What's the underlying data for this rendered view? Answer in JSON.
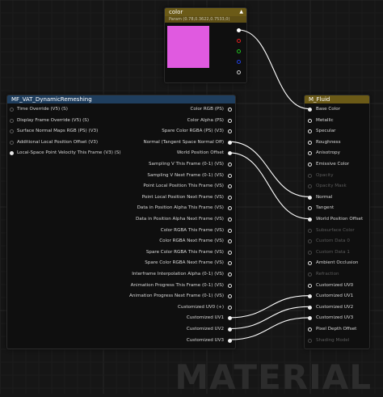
{
  "color_node": {
    "title": "color",
    "subtitle": "Param (0.78,0.3622,0.7533,0)",
    "swatch_color": "#e05ae0",
    "header_color": "#6b5a17",
    "output_pins": [
      "white",
      "red",
      "green",
      "blue",
      "alpha"
    ]
  },
  "mf_node": {
    "title": "MF_VAT_DynamicRemeshing",
    "header_color": "#1f3e5e",
    "inputs": [
      "Time Override (V5) (S)",
      "Display Frame Override (V5) (S)",
      "Surface Normal Maps RGB (PS) (V3)",
      "Additional Local Position Offset (V3)",
      "Local-Space Point Velocity This Frame (V3) (S)"
    ],
    "outputs": [
      "Color RGB (PS)",
      "Color Alpha (PS)",
      "Spare Color RGBA (PS) (V3)",
      "Normal (Tangent Space Normal Off)",
      "World Position Offset",
      "Sampling V This Frame (0-1) (VS)",
      "Sampling V Next Frame (0-1) (VS)",
      "Point Local Position This Frame (VS)",
      "Point Local Position Next Frame (VS)",
      "Data in Position Alpha This Frame (VS)",
      "Data in Position Alpha Next Frame (VS)",
      "Color RGBA This Frame (VS)",
      "Color RGBA Next Frame (VS)",
      "Spare Color RGBA This Frame (VS)",
      "Spare Color RGBA Next Frame (VS)",
      "Interframe Interpolation Alpha (0-1) (VS)",
      "Animation Progress This Frame (0-1) (VS)",
      "Animation Progress Next Frame (0-1) (VS)",
      "Customized UV0 (+)",
      "Customized UV1",
      "Customized UV2",
      "Customized UV3"
    ]
  },
  "fluid_node": {
    "title": "M_Fluid",
    "header_color": "#6b5a17",
    "inputs": [
      {
        "label": "Base Color",
        "dim": false
      },
      {
        "label": "Metallic",
        "dim": false
      },
      {
        "label": "Specular",
        "dim": false
      },
      {
        "label": "Roughness",
        "dim": false
      },
      {
        "label": "Anisotropy",
        "dim": false
      },
      {
        "label": "Emissive Color",
        "dim": false
      },
      {
        "label": "Opacity",
        "dim": true
      },
      {
        "label": "Opacity Mask",
        "dim": true
      },
      {
        "label": "Normal",
        "dim": false
      },
      {
        "label": "Tangent",
        "dim": false
      },
      {
        "label": "World Position Offset",
        "dim": false
      },
      {
        "label": "Subsurface Color",
        "dim": true
      },
      {
        "label": "Custom Data 0",
        "dim": true
      },
      {
        "label": "Custom Data 1",
        "dim": true
      },
      {
        "label": "Ambient Occlusion",
        "dim": false
      },
      {
        "label": "Refraction",
        "dim": true
      },
      {
        "label": "Customized UV0",
        "dim": false
      },
      {
        "label": "Customized UV1",
        "dim": false
      },
      {
        "label": "Customized UV2",
        "dim": false
      },
      {
        "label": "Customized UV3",
        "dim": false
      },
      {
        "label": "Pixel Depth Offset",
        "dim": false
      },
      {
        "label": "Shading Model",
        "dim": true
      }
    ]
  },
  "watermark": "MATERIAL",
  "colors": {
    "background": "#161616",
    "grid": "#1e1e1e",
    "wire": "#ffffff",
    "pin_red": "#e02020",
    "pin_green": "#20c020",
    "pin_blue": "#2040e0"
  }
}
